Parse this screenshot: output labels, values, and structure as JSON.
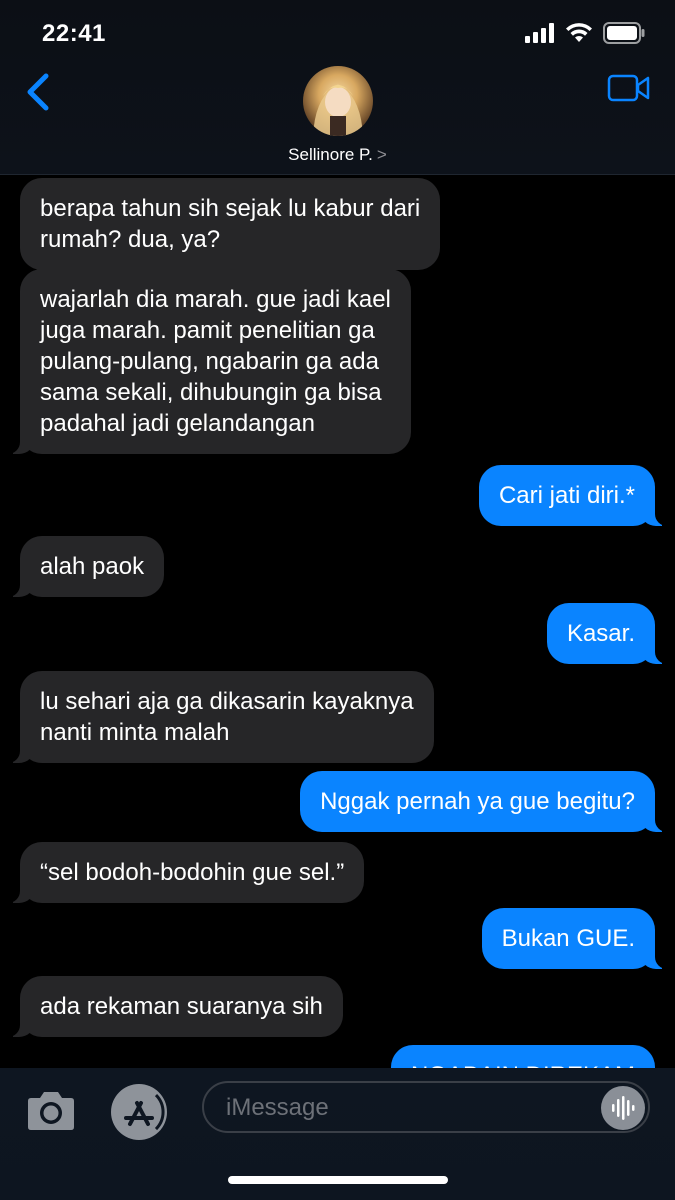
{
  "status": {
    "time": "22:41"
  },
  "header": {
    "contact_name": "Sellinore P.",
    "chevron": ">"
  },
  "messages": [
    {
      "from": "them",
      "lines": [
        "berapa tahun sih sejak lu kabur dari",
        "rumah? dua, ya?"
      ]
    },
    {
      "from": "them",
      "lines": [
        "wajarlah dia marah. gue jadi kael",
        "juga marah. pamit penelitian ga",
        "pulang-pulang, ngabarin ga ada",
        "sama sekali, dihubungin ga bisa",
        "padahal jadi gelandangan"
      ]
    },
    {
      "from": "me",
      "lines": [
        "Cari jati diri.*"
      ]
    },
    {
      "from": "them",
      "lines": [
        "alah paok"
      ]
    },
    {
      "from": "me",
      "lines": [
        "Kasar."
      ]
    },
    {
      "from": "them",
      "lines": [
        "lu sehari aja ga dikasarin kayaknya",
        "nanti minta malah"
      ]
    },
    {
      "from": "me",
      "lines": [
        "Nggak pernah ya gue begitu?"
      ]
    },
    {
      "from": "them",
      "lines": [
        "“sel bodoh-bodohin gue sel.”"
      ]
    },
    {
      "from": "me",
      "lines": [
        "Bukan GUE."
      ]
    },
    {
      "from": "them",
      "lines": [
        "ada rekaman suaranya sih"
      ]
    },
    {
      "from": "me",
      "lines": [
        "NGABAIN DIREKAM"
      ]
    }
  ],
  "composer": {
    "placeholder": "iMessage"
  },
  "colors": {
    "sent": "#0a84ff",
    "received": "#262628",
    "background": "#000000"
  }
}
